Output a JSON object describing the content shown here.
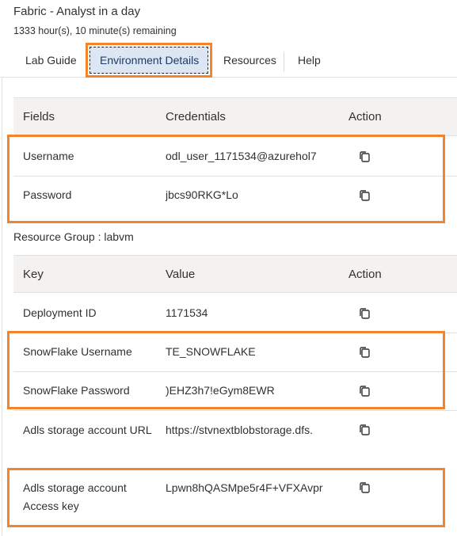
{
  "app": {
    "title": "Fabric - Analyst in a day",
    "remaining": "1333 hour(s), 10 minute(s) remaining"
  },
  "tabs": [
    {
      "label": "Lab Guide",
      "active": false
    },
    {
      "label": "Environment Details",
      "active": true
    },
    {
      "label": "Resources",
      "active": false
    },
    {
      "label": "Help",
      "active": false
    }
  ],
  "credentials_table": {
    "headers": [
      "Fields",
      "Credentials",
      "Action"
    ],
    "rows": [
      {
        "field": "Username",
        "value": "odl_user_1171534@azurehol7",
        "action_icon": "copy-icon"
      },
      {
        "field": "Password",
        "value": "jbcs90RKG*Lo",
        "action_icon": "copy-icon"
      }
    ]
  },
  "resource_group": {
    "label": "Resource Group : labvm"
  },
  "resource_table": {
    "headers": [
      "Key",
      "Value",
      "Action"
    ],
    "rows": [
      {
        "key": "Deployment ID",
        "value": "1171534",
        "action_icon": "copy-icon"
      },
      {
        "key": "SnowFlake Username",
        "value": "TE_SNOWFLAKE",
        "action_icon": "copy-icon"
      },
      {
        "key": "SnowFlake Password",
        "value": ")EHZ3h7!eGym8EWR",
        "action_icon": "copy-icon"
      },
      {
        "key": "Adls storage account URL",
        "value": "https://stvnextblobstorage.dfs.",
        "action_icon": "copy-icon"
      },
      {
        "key": "Adls storage account Access key",
        "value": "Lpwn8hQASMpe5r4F+VFXAvpr",
        "action_icon": "copy-icon"
      }
    ]
  },
  "colors": {
    "highlight": "#f5832a",
    "header_bg": "#f3f2f1",
    "active_tab_bg": "#dde6f3",
    "text": "#323130"
  }
}
